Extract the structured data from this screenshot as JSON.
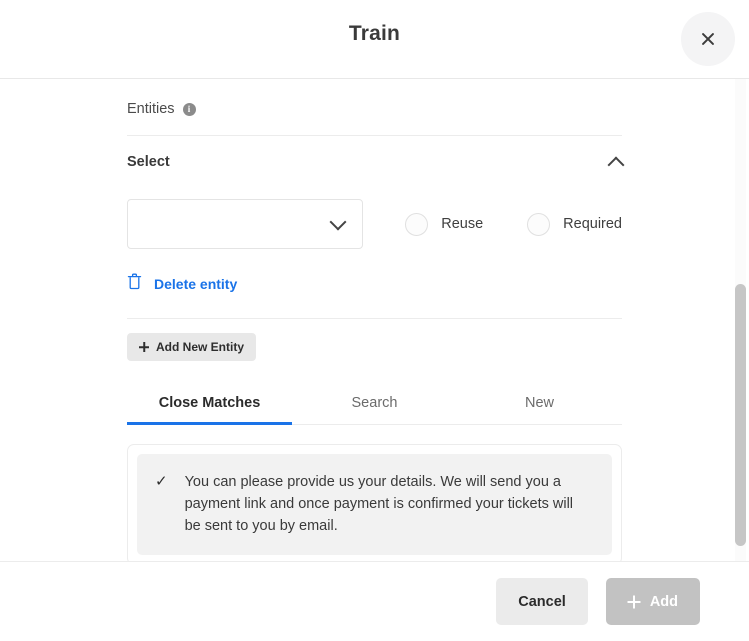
{
  "header": {
    "title": "Train",
    "close_icon": "close-icon"
  },
  "entities_section": {
    "label": "Entities",
    "info_icon": "info-icon",
    "info_glyph": "i"
  },
  "select_group": {
    "title": "Select",
    "collapse_icon": "chevron-up-icon",
    "dropdown": {
      "value": "",
      "placeholder": "",
      "icon": "chevron-down-icon"
    },
    "options": [
      {
        "label": "Reuse",
        "checked": false
      },
      {
        "label": "Required",
        "checked": false
      }
    ],
    "delete_entity": {
      "label": "Delete entity",
      "icon": "trash-icon",
      "color": "#1a73e8"
    }
  },
  "add_new_entity": {
    "label": "Add New Entity",
    "icon": "plus-icon"
  },
  "tabs": [
    {
      "label": "Close Matches",
      "active": true
    },
    {
      "label": "Search",
      "active": false
    },
    {
      "label": "New",
      "active": false
    }
  ],
  "results": [
    {
      "icon": "check-icon",
      "check_glyph": "✓",
      "text": "You can please provide us your details. We will send you a payment link and once payment is confirmed your tickets will be sent to you by email."
    }
  ],
  "footer": {
    "cancel_label": "Cancel",
    "add_label": "Add",
    "add_icon": "plus-icon",
    "add_disabled": true
  },
  "colors": {
    "accent": "#1a73e8",
    "surface": "#ffffff",
    "muted": "#f2f2f2",
    "border": "#ececec",
    "disabled": "#c2c2c2"
  }
}
